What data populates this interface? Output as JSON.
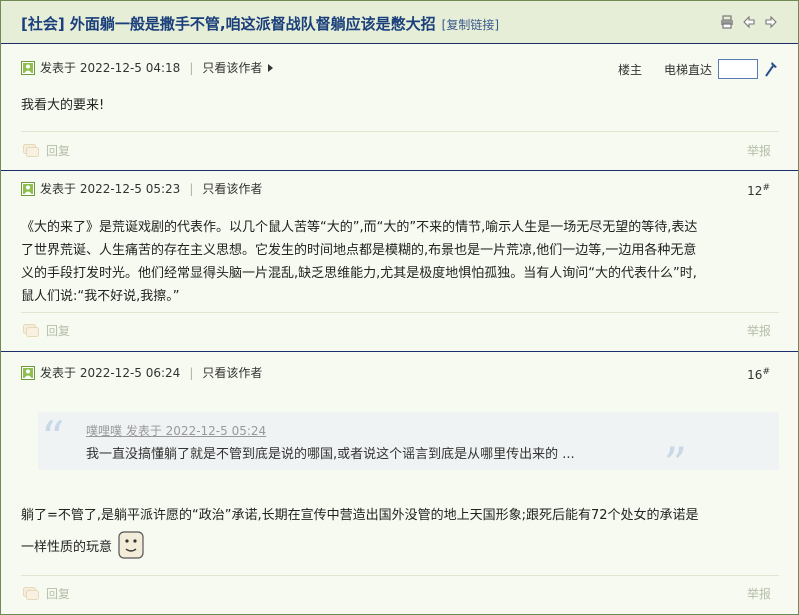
{
  "thread": {
    "title": "[社会] 外面躺一般是撒手不管,咱这派督战队督躺应该是憋大招",
    "copy_link": "[复制链接]"
  },
  "toolbar": {
    "louzhu": "楼主",
    "elevator": "电梯直达",
    "elevator_value": ""
  },
  "posts": [
    {
      "posted": "发表于 2022-12-5 04:18",
      "only_author": "只看该作者",
      "floor": "",
      "content": "我看大的要来!",
      "reply": "回复",
      "report": "举报"
    },
    {
      "posted": "发表于 2022-12-5 05:23",
      "only_author": "只看该作者",
      "floor": "12",
      "floor_mark": "#",
      "content_lines": [
        "《大的来了》是荒诞戏剧的代表作。以几个鼠人苦等“大的”,而“大的”不来的情节,喻示人生是一场无尽无望的等待,表达",
        "了世界荒诞、人生痛苦的存在主义思想。它发生的时间地点都是模糊的,布景也是一片荒凉,他们一边等,一边用各种无意",
        "义的手段打发时光。他们经常显得头脑一片混乱,缺乏思维能力,尤其是极度地惧怕孤独。当有人询问“大的代表什么”时,",
        "鼠人们说:“我不好说,我擦。”"
      ],
      "reply": "回复",
      "report": "举报"
    },
    {
      "posted": "发表于 2022-12-5 06:24",
      "only_author": "只看该作者",
      "floor": "16",
      "floor_mark": "#",
      "quote": {
        "author": "噗哩噗",
        "time": "发表于 2022-12-5 05:24",
        "text": "我一直没搞懂躺了就是不管到底是说的哪国,或者说这个谣言到底是从哪里传出来的 ..."
      },
      "content_lines": [
        "躺了=不管了,是躺平派许愿的“政治”承诺,长期在宣传中营造出国外没管的地上天国形象;跟死后能有72个处女的承诺是",
        "一样性质的玩意"
      ],
      "reply": "回复",
      "report": "举报"
    }
  ],
  "colors": {
    "title": "#1a3f7a",
    "separator": "#1b2e6b",
    "background": "#f7faf0",
    "muted": "#b5bfa8"
  },
  "icons": [
    "print-icon",
    "prev-thread-icon",
    "next-thread-icon",
    "user-icon",
    "reply-icon",
    "go-icon",
    "smiley-icon"
  ]
}
